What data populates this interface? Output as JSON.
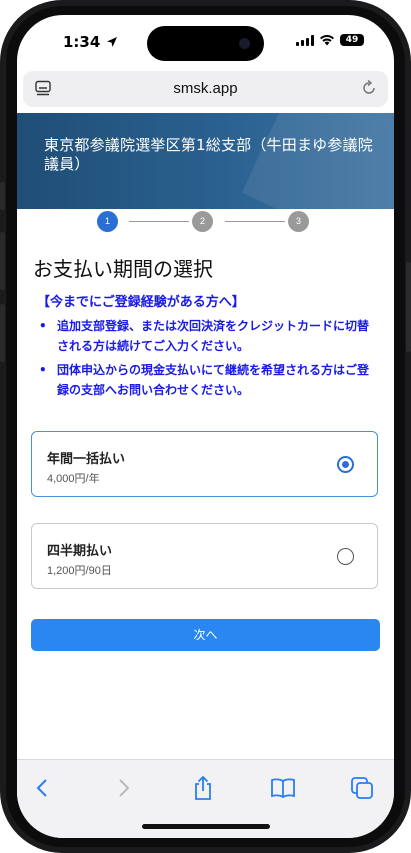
{
  "status": {
    "time": "1:34",
    "battery": "49"
  },
  "browser": {
    "url": "smsk.app"
  },
  "header": {
    "title": "東京都参議院選挙区第1総支部（牛田まゆ参議院議員）"
  },
  "steps": [
    "1",
    "2",
    "3"
  ],
  "page": {
    "heading": "お支払い期間の選択"
  },
  "notice": {
    "title": "【今までにご登録経験がある方へ】",
    "items": [
      "追加支部登録、または次回決済をクレジットカードに切替される方は続けてご入力ください。",
      "団体申込からの現金支払いにて継続を希望される方はご登録の支部へお問い合わせください。"
    ]
  },
  "options": [
    {
      "title": "年間一括払い",
      "price": "4,000円/年",
      "selected": true
    },
    {
      "title": "四半期払い",
      "price": "1,200円/90日",
      "selected": false
    }
  ],
  "actions": {
    "next_label": "次へ"
  },
  "colors": {
    "accent": "#2a86f0",
    "notice_text": "#1a1ae8",
    "banner": "#2b6190",
    "selected_border": "#4a90d9"
  }
}
